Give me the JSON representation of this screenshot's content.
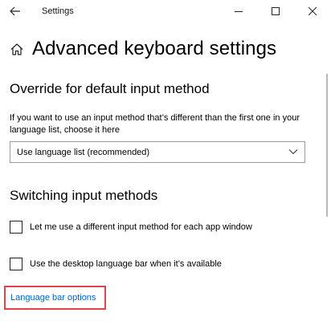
{
  "window": {
    "title": "Settings",
    "icons": {
      "back": "back-arrow-icon",
      "minimize": "minimize-icon",
      "maximize": "maximize-icon",
      "close": "close-icon"
    }
  },
  "page": {
    "home_icon": "home-icon",
    "title": "Advanced keyboard settings"
  },
  "override_section": {
    "heading": "Override for default input method",
    "description": "If you want to use an input method that’s different than the first one in your language list, choose it here",
    "dropdown": {
      "selected": "Use language list (recommended)",
      "icon": "chevron-down-icon"
    }
  },
  "switching_section": {
    "heading": "Switching input methods",
    "options": [
      {
        "label": "Let me use a different input method for each app window",
        "checked": false
      },
      {
        "label": "Use the desktop language bar when it’s available",
        "checked": false
      }
    ]
  },
  "link": {
    "label": "Language bar options",
    "highlight_color": "#e0424f",
    "color": "#0067c0"
  }
}
